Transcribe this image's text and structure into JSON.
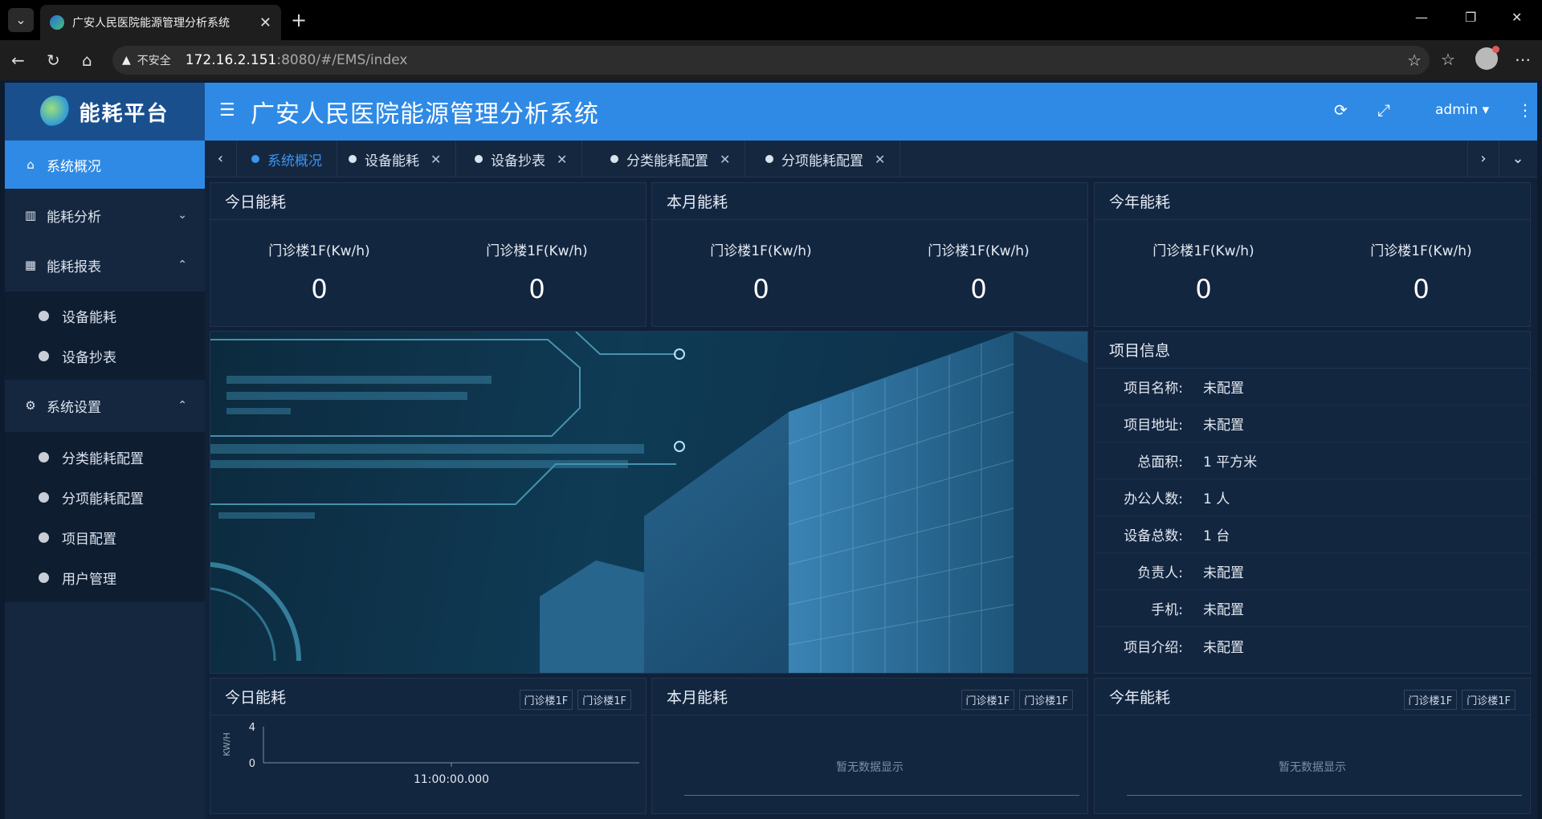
{
  "browser": {
    "tab_title": "广安人民医院能源管理分析系统",
    "url_warning": "不安全",
    "url_host": "172.16.2.151",
    "url_path": ":8080/#/EMS/index"
  },
  "sidebar": {
    "logo_text": "能耗平台",
    "items": [
      {
        "label": "系统概况",
        "icon": "home-icon"
      },
      {
        "label": "能耗分析",
        "icon": "bar-chart-icon"
      },
      {
        "label": "能耗报表",
        "icon": "table-icon"
      },
      {
        "label": "系统设置",
        "icon": "gear-icon"
      }
    ],
    "report_sub": [
      "设备能耗",
      "设备抄表"
    ],
    "settings_sub": [
      "分类能耗配置",
      "分项能耗配置",
      "项目配置",
      "用户管理"
    ]
  },
  "header": {
    "title": "广安人民医院能源管理分析系统",
    "user": "admin"
  },
  "page_tabs": [
    {
      "label": "系统概况",
      "active": true
    },
    {
      "label": "设备能耗"
    },
    {
      "label": "设备抄表"
    },
    {
      "label": "分类能耗配置"
    },
    {
      "label": "分项能耗配置"
    }
  ],
  "kpi": [
    {
      "title": "今日能耗",
      "items": [
        {
          "label": "门诊楼1F(Kw/h)",
          "value": "0"
        },
        {
          "label": "门诊楼1F(Kw/h)",
          "value": "0"
        }
      ]
    },
    {
      "title": "本月能耗",
      "items": [
        {
          "label": "门诊楼1F(Kw/h)",
          "value": "0"
        },
        {
          "label": "门诊楼1F(Kw/h)",
          "value": "0"
        }
      ]
    },
    {
      "title": "今年能耗",
      "items": [
        {
          "label": "门诊楼1F(Kw/h)",
          "value": "0"
        },
        {
          "label": "门诊楼1F(Kw/h)",
          "value": "0"
        }
      ]
    }
  ],
  "project_info": {
    "title": "项目信息",
    "rows": [
      {
        "k": "项目名称:",
        "v": "未配置"
      },
      {
        "k": "项目地址:",
        "v": "未配置"
      },
      {
        "k": "总面积:",
        "v": "1 平方米"
      },
      {
        "k": "办公人数:",
        "v": "1 人"
      },
      {
        "k": "设备总数:",
        "v": "1 台"
      },
      {
        "k": "负责人:",
        "v": "未配置"
      },
      {
        "k": "手机:",
        "v": "未配置"
      },
      {
        "k": "项目介绍:",
        "v": "未配置"
      }
    ]
  },
  "charts": [
    {
      "title": "今日能耗",
      "legend": [
        "门诊楼1F",
        "门诊楼1F"
      ]
    },
    {
      "title": "本月能耗",
      "legend": [
        "门诊楼1F",
        "门诊楼1F"
      ],
      "empty_text": "暂无数据显示"
    },
    {
      "title": "今年能耗",
      "legend": [
        "门诊楼1F",
        "门诊楼1F"
      ],
      "empty_text": "暂无数据显示"
    }
  ],
  "chart_data": {
    "type": "line",
    "ylabel": "KW/H",
    "ylim": [
      0,
      4
    ],
    "yticks": [
      "4",
      "0"
    ],
    "x": [
      "11:00:00.000"
    ],
    "series": []
  }
}
